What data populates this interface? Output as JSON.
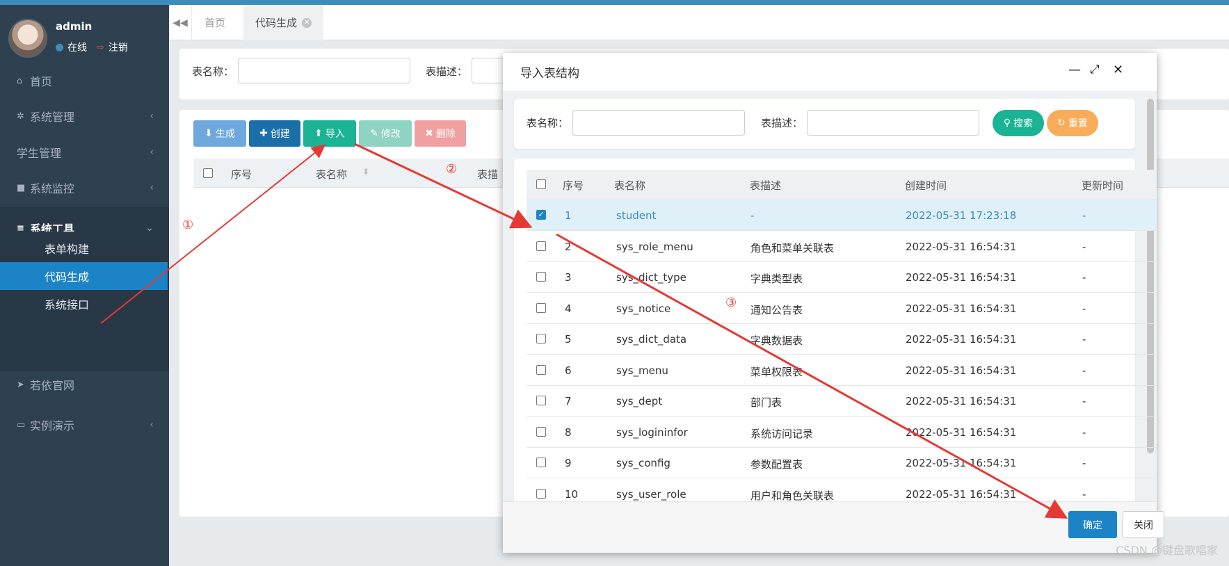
{
  "sidebar": {
    "user": {
      "name": "admin",
      "status": "在线",
      "logout": "注销"
    },
    "items": [
      {
        "label": "首页",
        "icon": "home-icon"
      },
      {
        "label": "系统管理",
        "icon": "gear-icon"
      },
      {
        "label": "学生管理",
        "icon": ""
      },
      {
        "label": "系统监控",
        "icon": "video-icon"
      },
      {
        "label": "系统工具",
        "icon": "bars-icon"
      },
      {
        "label": "若依官网",
        "icon": "send-icon"
      },
      {
        "label": "实例演示",
        "icon": "desktop-icon"
      }
    ],
    "sub_items": [
      {
        "label": "表单构建"
      },
      {
        "label": "代码生成"
      },
      {
        "label": "系统接口"
      }
    ]
  },
  "tabs": [
    {
      "label": "首页"
    },
    {
      "label": "代码生成"
    }
  ],
  "search": {
    "table_name_label": "表名称：",
    "table_desc_label": "表描述："
  },
  "toolbar": {
    "generate": "生成",
    "create": "创建",
    "import": "导入",
    "edit": "修改",
    "delete": "删除"
  },
  "table_headers": {
    "index": "序号",
    "name": "表名称",
    "desc": "表描"
  },
  "modal": {
    "title": "导入表结构",
    "search": {
      "name_label": "表名称：",
      "desc_label": "表描述：",
      "search_btn": "搜索",
      "reset_btn": "重置"
    },
    "headers": {
      "index": "序号",
      "name": "表名称",
      "desc": "表描述",
      "created": "创建时间",
      "updated": "更新时间"
    },
    "rows": [
      {
        "index": "1",
        "name": "student",
        "desc": "-",
        "created": "2022-05-31 17:23:18",
        "updated": "-",
        "checked": true
      },
      {
        "index": "2",
        "name": "sys_role_menu",
        "desc": "角色和菜单关联表",
        "created": "2022-05-31 16:54:31",
        "updated": "-",
        "checked": false
      },
      {
        "index": "3",
        "name": "sys_dict_type",
        "desc": "字典类型表",
        "created": "2022-05-31 16:54:31",
        "updated": "-",
        "checked": false
      },
      {
        "index": "4",
        "name": "sys_notice",
        "desc": "通知公告表",
        "created": "2022-05-31 16:54:31",
        "updated": "-",
        "checked": false
      },
      {
        "index": "5",
        "name": "sys_dict_data",
        "desc": "字典数据表",
        "created": "2022-05-31 16:54:31",
        "updated": "-",
        "checked": false
      },
      {
        "index": "6",
        "name": "sys_menu",
        "desc": "菜单权限表",
        "created": "2022-05-31 16:54:31",
        "updated": "-",
        "checked": false
      },
      {
        "index": "7",
        "name": "sys_dept",
        "desc": "部门表",
        "created": "2022-05-31 16:54:31",
        "updated": "-",
        "checked": false
      },
      {
        "index": "8",
        "name": "sys_logininfor",
        "desc": "系统访问记录",
        "created": "2022-05-31 16:54:31",
        "updated": "-",
        "checked": false
      },
      {
        "index": "9",
        "name": "sys_config",
        "desc": "参数配置表",
        "created": "2022-05-31 16:54:31",
        "updated": "-",
        "checked": false
      },
      {
        "index": "10",
        "name": "sys_user_role",
        "desc": "用户和角色关联表",
        "created": "2022-05-31 16:54:31",
        "updated": "-",
        "checked": false
      }
    ],
    "confirm": "确定",
    "close": "关闭"
  },
  "annotations": {
    "a1": "①",
    "a2": "②",
    "a3": "③"
  },
  "watermark": "CSDN @键盘歌唱家",
  "colors": {
    "sidebar": "#2f4050",
    "active": "#1c84c6",
    "arrow": "#e53935",
    "btn_generate": "#6fa8dc",
    "btn_create": "#1a6fa8",
    "btn_import": "#1ab394",
    "btn_edit": "#8fd3c3",
    "btn_delete": "#f0a0a0",
    "search": "#1ab394",
    "reset": "#f8ac59"
  }
}
